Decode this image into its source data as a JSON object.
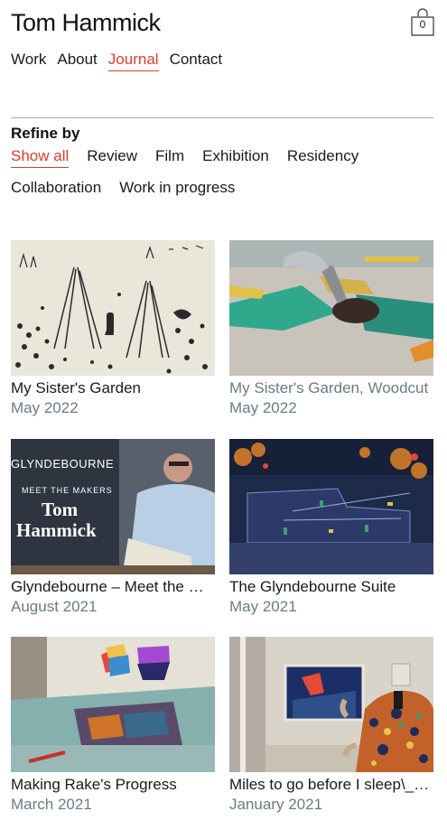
{
  "header": {
    "site_title": "Tom Hammick",
    "cart_count": "0",
    "cart_icon": "shopping-bag-icon"
  },
  "nav": [
    {
      "label": "Work",
      "active": false
    },
    {
      "label": "About",
      "active": false
    },
    {
      "label": "Journal",
      "active": true
    },
    {
      "label": "Contact",
      "active": false
    }
  ],
  "refine": {
    "label": "Refine by",
    "filters": [
      {
        "label": "Show all",
        "active": true
      },
      {
        "label": "Review",
        "active": false
      },
      {
        "label": "Film",
        "active": false
      },
      {
        "label": "Exhibition",
        "active": false
      },
      {
        "label": "Residency",
        "active": false
      },
      {
        "label": "Collaboration",
        "active": false
      },
      {
        "label": "Work in progress",
        "active": false
      }
    ]
  },
  "colors": {
    "accent": "#e03a2f",
    "muted_text": "#6c7a86",
    "divider": "#9fb0b3"
  },
  "posts": [
    {
      "title": "My Sister's Garden",
      "date": "May 2022",
      "title_muted": false
    },
    {
      "title": "My Sister's Garden, Woodcut",
      "date": "May 2022",
      "title_muted": true
    },
    {
      "title": "Glyndebourne – Meet the Makers",
      "date": "August 2021",
      "title_muted": false,
      "thumb_text": {
        "line1": "GLYNDEBOURNE",
        "line2": "MEET THE MAKERS",
        "line3": "Tom",
        "line4": "Hammick"
      }
    },
    {
      "title": "The Glyndebourne Suite",
      "date": "May 2021",
      "title_muted": false
    },
    {
      "title": "Making Rake's Progress",
      "date": "March 2021",
      "title_muted": false
    },
    {
      "title": "Miles to go before I sleep\\_a...",
      "date": "January 2021",
      "title_muted": false
    }
  ]
}
